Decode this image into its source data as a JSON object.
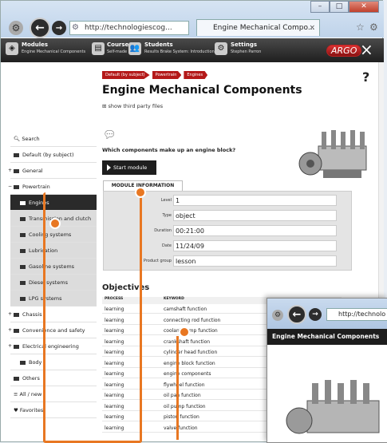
{
  "browser": {
    "address": "http://technologiescog...",
    "tab_title": "Engine Mechanical Compo...",
    "tab_close": "×"
  },
  "appbar": {
    "modules_title": "Modules",
    "modules_sub": "Engine Mechanical Components",
    "courses_title": "Courses",
    "courses_sub": "Self-made",
    "students_title": "Students",
    "students_sub": "Results Brake System: Introduction",
    "settings_title": "Settings",
    "settings_sub": "Stephen Parron",
    "logo": "ARGO",
    "close": "×"
  },
  "breadcrumbs": [
    "Default (by subject)",
    "Powertrain",
    "Engines"
  ],
  "page_title": "Engine Mechanical Components",
  "help": "?",
  "third_party": "show third party files",
  "sidebar": [
    {
      "label": "Search",
      "style": "plain"
    },
    {
      "label": "Default (by subject)",
      "style": "plain"
    },
    {
      "label": "General",
      "style": "plain"
    },
    {
      "label": "Powertrain",
      "style": "plain"
    },
    {
      "label": "Engines",
      "style": "dark"
    },
    {
      "label": "Transmission and clutch",
      "style": "grey"
    },
    {
      "label": "Cooling systems",
      "style": "grey"
    },
    {
      "label": "Lubrication",
      "style": "grey"
    },
    {
      "label": "Gasoline systems",
      "style": "grey"
    },
    {
      "label": "Diesel systems",
      "style": "grey"
    },
    {
      "label": "LPG systems",
      "style": "grey"
    },
    {
      "label": "Chassis",
      "style": "plain"
    },
    {
      "label": "Convenience and safety",
      "style": "plain"
    },
    {
      "label": "Electrical engineering",
      "style": "plain"
    },
    {
      "label": "Body",
      "style": "plain"
    },
    {
      "label": "Others",
      "style": "plain"
    },
    {
      "label": "All / new",
      "style": "plain"
    },
    {
      "label": "Favorites",
      "style": "plain"
    }
  ],
  "question": "Which components make up an engine block?",
  "start_module": "Start module",
  "module_info_tab": "MODULE INFORMATION",
  "module_info": [
    {
      "label": "Level",
      "value": "1"
    },
    {
      "label": "Type",
      "value": "object"
    },
    {
      "label": "Duration",
      "value": "00:21:00"
    },
    {
      "label": "Date",
      "value": "11/24/09"
    },
    {
      "label": "Product group",
      "value": "lesson"
    }
  ],
  "objectives_title": "Objectives",
  "objectives_headers": [
    "PROCESS",
    "KEYWORD"
  ],
  "objectives": [
    [
      "learning",
      "camshaft function"
    ],
    [
      "learning",
      "connecting rod function"
    ],
    [
      "learning",
      "coolant pump function"
    ],
    [
      "learning",
      "crankshaft function"
    ],
    [
      "learning",
      "cylinder head function"
    ],
    [
      "learning",
      "engine block function"
    ],
    [
      "learning",
      "engine components"
    ],
    [
      "learning",
      "flywheel function"
    ],
    [
      "learning",
      "oil pan function"
    ],
    [
      "learning",
      "oil pump function"
    ],
    [
      "learning",
      "piston function"
    ],
    [
      "learning",
      "valve function"
    ]
  ],
  "pip": {
    "address": "http://technolo",
    "title": "Engine Mechanical Components"
  },
  "colors": {
    "accent": "#b41919",
    "highlight": "#e87722"
  }
}
